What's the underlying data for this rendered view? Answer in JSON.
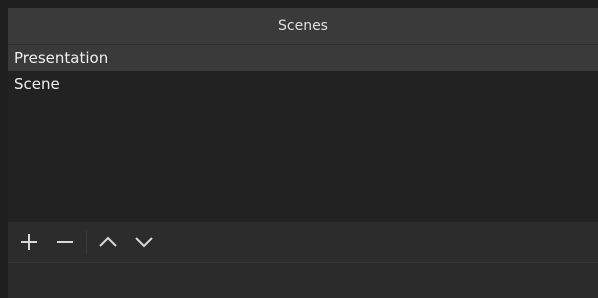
{
  "dock": {
    "title": "Scenes"
  },
  "scenes": {
    "items": [
      {
        "label": "Presentation",
        "selected": true
      },
      {
        "label": "Scene",
        "selected": false
      }
    ]
  },
  "toolbar": {
    "buttons": [
      {
        "icon": "plus-icon"
      },
      {
        "icon": "minus-icon"
      },
      {
        "icon": "chevron-up-icon"
      },
      {
        "icon": "chevron-down-icon"
      }
    ]
  },
  "colors": {
    "background": "#1f1f1f",
    "title_bar": "#3a3a3a",
    "selected_row": "#3a3a3a",
    "toolbar": "#2c2c2c",
    "icon": "#d8d8d8"
  }
}
